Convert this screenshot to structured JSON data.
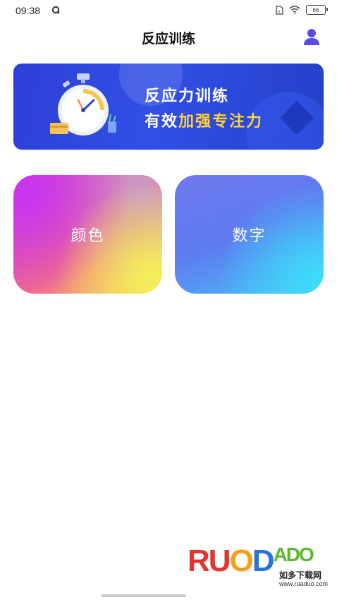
{
  "status_bar": {
    "time": "09:38",
    "battery": "66"
  },
  "header": {
    "title": "反应训练"
  },
  "banner": {
    "line1": "反应力训练",
    "line2_part1": "有效",
    "line2_part2": "加强专注力"
  },
  "cards": {
    "color_label": "颜色",
    "number_label": "数字"
  },
  "watermark": {
    "logo_r": "R",
    "logo_u": "U",
    "logo_o": "O",
    "logo_d": "D",
    "logo_ado": "ADO",
    "cn": "如多下载网",
    "url": "www.ruaduo.com"
  },
  "colors": {
    "accent": "#5b4be6",
    "banner_bg": "#3150e6",
    "banner_highlight": "#ffd23a"
  },
  "icons": {
    "profile": "user-icon",
    "wifi": "wifi-icon",
    "sim": "sim-icon",
    "notification": "q-icon"
  }
}
